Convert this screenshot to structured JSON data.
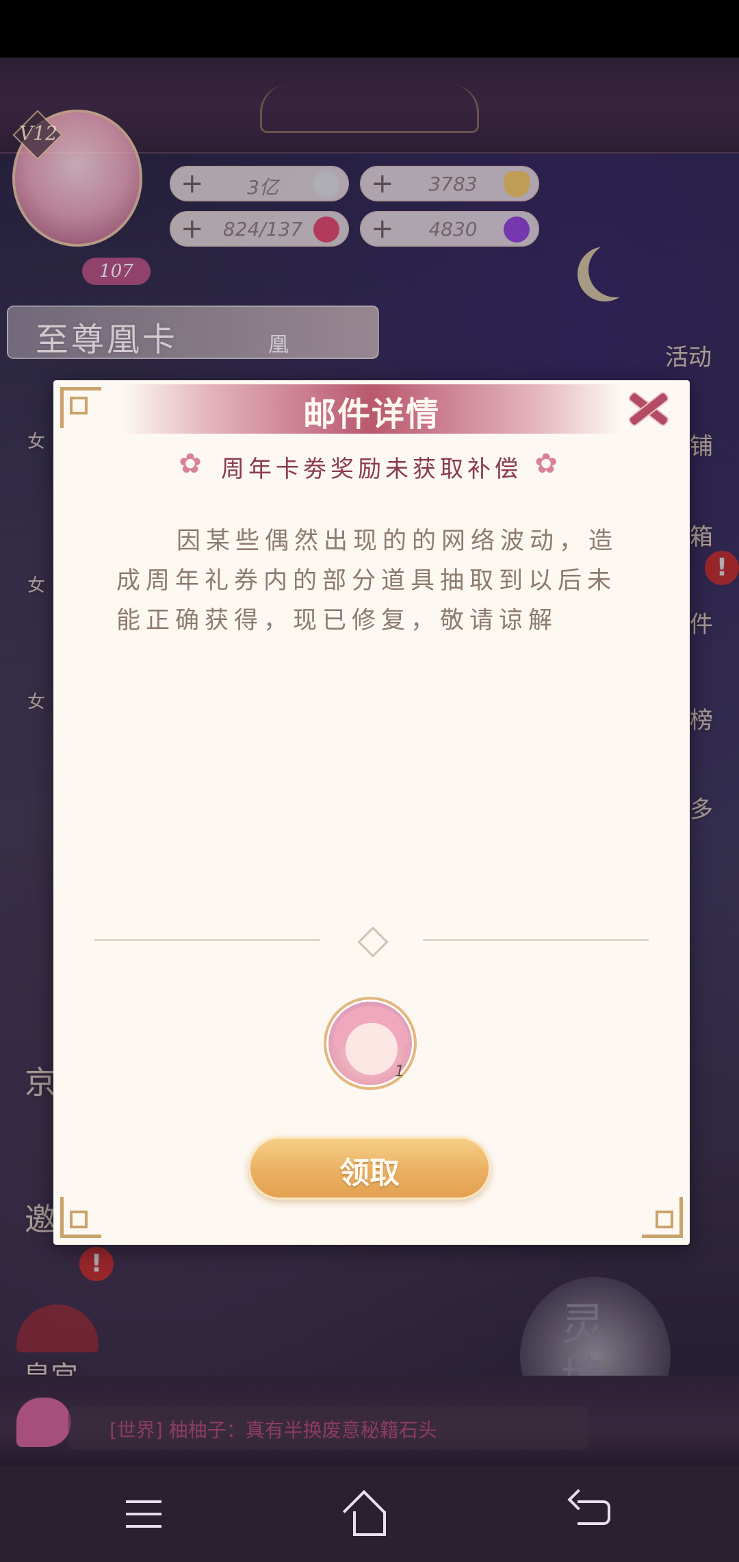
{
  "player": {
    "vip_level": "V12",
    "level": "107"
  },
  "resources": [
    {
      "value": "3亿",
      "icon": "silver-coin-icon"
    },
    {
      "value": "3783",
      "icon": "gold-ingot-icon"
    },
    {
      "value": "824/137",
      "icon": "heart-icon"
    },
    {
      "value": "4830",
      "icon": "purple-gem-icon"
    }
  ],
  "banner": {
    "supreme_card": "至尊凰卡",
    "supreme_card_badge": "凰"
  },
  "side_menu": {
    "activity": "活动",
    "shop": "铺",
    "box": "箱",
    "mail": "件",
    "rank": "榜",
    "more": "多",
    "left_1": "女",
    "left_2": "女",
    "left_3": "女",
    "capital": "京",
    "invite": "邀"
  },
  "bottom": {
    "palace": "皇宫",
    "realm": "灵境",
    "chat_message": "[世界] 柚柚子：真有半换废意秘籍石头",
    "alert_mark": "!"
  },
  "dialog": {
    "title": "邮件详情",
    "subject": "周年卡劵奖励未获取补偿",
    "body": "因某些偶然出现的的网络波动，造成周年礼券内的部分道具抽取到以后未能正确获得，现已修复，敬请谅解",
    "reward_count": "1",
    "claim_label": "领取"
  },
  "colors": {
    "dialog_bg": "#fdf8f1",
    "title_accent": "#b9586f",
    "subject_color": "#8a3a4e",
    "body_color": "#8d7b6f",
    "claim_button": "#eab063"
  }
}
